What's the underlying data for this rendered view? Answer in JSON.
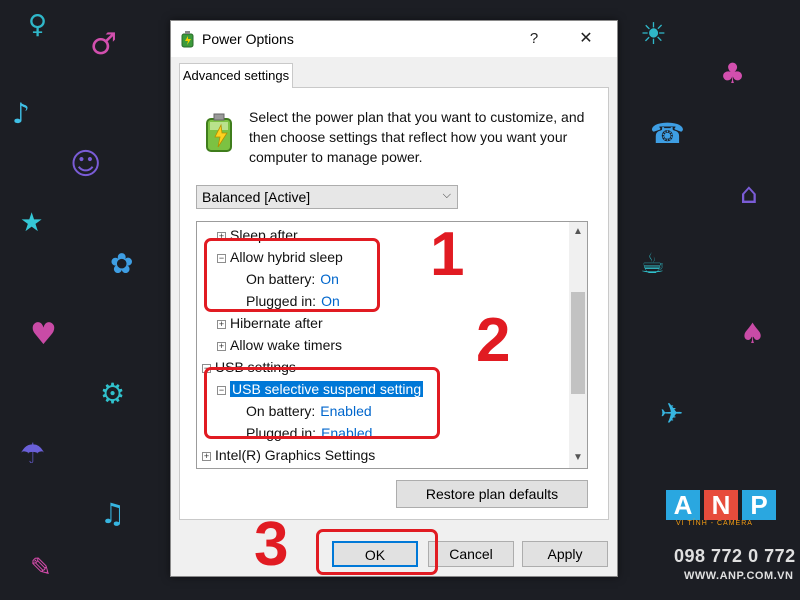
{
  "dialog": {
    "title": "Power Options",
    "help_glyph": "?",
    "close_glyph": "✕",
    "tab_label": "Advanced settings",
    "intro_text": "Select the power plan that you want to customize, and then choose settings that reflect how you want your computer to manage power.",
    "plan_select": {
      "value": "Balanced [Active]",
      "chevron": "⌵"
    },
    "tree": [
      {
        "label": "Sleep after",
        "expander": "+"
      },
      {
        "label": "Allow hybrid sleep",
        "expander": "−"
      },
      {
        "label": "On battery:",
        "value": "On"
      },
      {
        "label": "Plugged in:",
        "value": "On"
      },
      {
        "label": "Hibernate after",
        "expander": "+"
      },
      {
        "label": "Allow wake timers",
        "expander": "+"
      },
      {
        "label": "USB settings",
        "expander": "−"
      },
      {
        "label": "USB selective suspend setting",
        "expander": "−"
      },
      {
        "label": "On battery:",
        "value": "Enabled"
      },
      {
        "label": "Plugged in:",
        "value": "Enabled"
      },
      {
        "label": "Intel(R) Graphics Settings",
        "expander": "+"
      }
    ],
    "scroll_up": "▲",
    "scroll_down": "▼",
    "restore_button": "Restore plan defaults",
    "ok_button": "OK",
    "cancel_button": "Cancel",
    "apply_button": "Apply"
  },
  "callouts": [
    "1",
    "2",
    "3"
  ],
  "callout_color": "#e11b22",
  "watermark": {
    "letters": [
      "A",
      "N",
      "P"
    ],
    "letter_colors": [
      "#2aa7e0",
      "#e74c3c",
      "#2aa7e0"
    ],
    "tagline": "VI TÍNH - CAMERA",
    "phone": "098 772 0 772",
    "url": "WWW.ANP.COM.VN"
  },
  "wallpaper": {
    "background": "#1c1e24",
    "doodles": [
      "♀",
      "♂",
      "♪",
      "☺",
      "★",
      "✿",
      "♥",
      "⚙",
      "☂",
      "♫",
      "✎",
      "☀",
      "♣",
      "☎",
      "⌂",
      "☕",
      "♠",
      "✈"
    ]
  }
}
